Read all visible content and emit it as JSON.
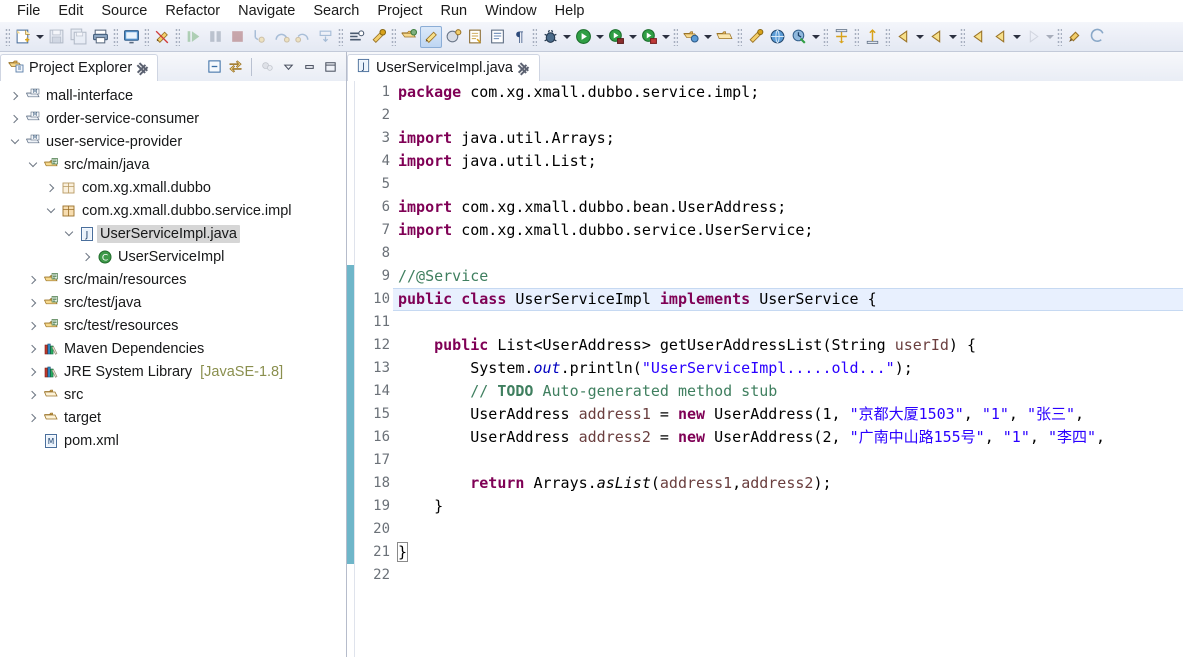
{
  "menu": {
    "items": [
      {
        "label": "File"
      },
      {
        "label": "Edit"
      },
      {
        "label": "Source"
      },
      {
        "label": "Refactor"
      },
      {
        "label": "Navigate"
      },
      {
        "label": "Search"
      },
      {
        "label": "Project"
      },
      {
        "label": "Run"
      },
      {
        "label": "Window"
      },
      {
        "label": "Help"
      }
    ]
  },
  "toolbar": {
    "groups": [
      {
        "buttons": [
          {
            "name": "new-wizard-icon",
            "enabled": true,
            "dropdown": true
          },
          {
            "name": "save-icon",
            "enabled": false
          },
          {
            "name": "save-all-icon",
            "enabled": false
          },
          {
            "name": "print-icon",
            "enabled": true
          }
        ]
      },
      {
        "buttons": [
          {
            "name": "open-console-icon",
            "enabled": true
          }
        ]
      },
      {
        "buttons": [
          {
            "name": "toggle-mark-occurrences-icon",
            "enabled": true
          }
        ]
      },
      {
        "buttons": [
          {
            "name": "resume-icon",
            "enabled": false
          },
          {
            "name": "suspend-icon",
            "enabled": false
          },
          {
            "name": "terminate-icon",
            "enabled": false
          },
          {
            "name": "step-into-icon",
            "enabled": false
          },
          {
            "name": "step-over-icon",
            "enabled": false
          },
          {
            "name": "step-return-icon",
            "enabled": false
          },
          {
            "name": "drop-to-frame-icon",
            "enabled": false
          }
        ]
      },
      {
        "buttons": [
          {
            "name": "skip-breakpoints-icon",
            "enabled": true
          },
          {
            "name": "run-last-tool-icon",
            "enabled": true
          }
        ]
      },
      {
        "buttons": [
          {
            "name": "new-java-project-icon",
            "enabled": true
          },
          {
            "name": "new-package-icon",
            "enabled": true,
            "highlighted": true
          },
          {
            "name": "new-class-icon",
            "enabled": true
          },
          {
            "name": "open-type-icon",
            "enabled": true
          },
          {
            "name": "open-task-icon",
            "enabled": true
          },
          {
            "name": "show-whitespace-icon",
            "enabled": true
          }
        ]
      },
      {
        "buttons": [
          {
            "name": "debug-icon",
            "enabled": true,
            "dropdown": true
          },
          {
            "name": "run-icon",
            "enabled": true,
            "dropdown": true
          },
          {
            "name": "run-server-icon",
            "enabled": true,
            "dropdown": true
          },
          {
            "name": "profile-icon",
            "enabled": true,
            "dropdown": true
          }
        ]
      },
      {
        "buttons": [
          {
            "name": "new-connection-icon",
            "enabled": true,
            "dropdown": true
          },
          {
            "name": "open-web-browser-icon",
            "enabled": true
          }
        ]
      },
      {
        "buttons": [
          {
            "name": "search-icon",
            "enabled": true
          },
          {
            "name": "open-resource-icon",
            "enabled": true
          },
          {
            "name": "external-tools-icon",
            "enabled": true,
            "dropdown": true
          }
        ]
      },
      {
        "buttons": [
          {
            "name": "globe-icon",
            "enabled": true
          }
        ]
      },
      {
        "buttons": [
          {
            "name": "deploy-icon",
            "enabled": true
          }
        ]
      },
      {
        "buttons": [
          {
            "name": "next-annotation-icon",
            "enabled": true,
            "dropdown": true
          },
          {
            "name": "previous-annotation-icon",
            "enabled": true,
            "dropdown": true
          }
        ]
      },
      {
        "buttons": [
          {
            "name": "back-icon",
            "enabled": true
          },
          {
            "name": "backward-history-icon",
            "enabled": true,
            "dropdown": true
          },
          {
            "name": "forward-history-icon",
            "enabled": false,
            "dropdown": true
          }
        ]
      },
      {
        "buttons": [
          {
            "name": "pin-editor-icon",
            "enabled": true
          },
          {
            "name": "last-edit-location-icon",
            "enabled": true
          }
        ]
      }
    ]
  },
  "explorer": {
    "tab": {
      "title": "Project Explorer",
      "icon": "project-explorer-icon",
      "close": "close-icon"
    },
    "toolbar": [
      {
        "name": "collapse-all-icon"
      },
      {
        "name": "link-with-editor-icon"
      },
      {
        "name": "focus-on-active-task-icon"
      },
      {
        "name": "view-menu-icon"
      },
      {
        "name": "minimize-icon"
      },
      {
        "name": "maximize-icon"
      }
    ],
    "tree": [
      {
        "label": "mall-interface",
        "indent": 0,
        "twisty": "closed",
        "icon": "maven-project-icon",
        "selected": false
      },
      {
        "label": "order-service-consumer",
        "indent": 0,
        "twisty": "closed",
        "icon": "maven-project-icon",
        "selected": false
      },
      {
        "label": "user-service-provider",
        "indent": 0,
        "twisty": "open",
        "icon": "maven-project-icon",
        "selected": false
      },
      {
        "label": "src/main/java",
        "indent": 1,
        "twisty": "open",
        "icon": "source-folder-icon",
        "selected": false
      },
      {
        "label": "com.xg.xmall.dubbo",
        "indent": 2,
        "twisty": "closed",
        "icon": "package-empty-icon",
        "selected": false
      },
      {
        "label": "com.xg.xmall.dubbo.service.impl",
        "indent": 2,
        "twisty": "open",
        "icon": "package-icon",
        "selected": false
      },
      {
        "label": "UserServiceImpl.java",
        "indent": 3,
        "twisty": "open",
        "icon": "java-file-icon",
        "selected": true
      },
      {
        "label": "UserServiceImpl",
        "indent": 4,
        "twisty": "closed",
        "icon": "java-class-icon",
        "selected": false
      },
      {
        "label": "src/main/resources",
        "indent": 1,
        "twisty": "closed",
        "icon": "source-folder-icon",
        "selected": false
      },
      {
        "label": "src/test/java",
        "indent": 1,
        "twisty": "closed",
        "icon": "source-folder-icon",
        "selected": false
      },
      {
        "label": "src/test/resources",
        "indent": 1,
        "twisty": "closed",
        "icon": "source-folder-icon",
        "selected": false
      },
      {
        "label": "Maven Dependencies",
        "indent": 1,
        "twisty": "closed",
        "icon": "library-icon",
        "selected": false
      },
      {
        "label": "JRE System Library",
        "indent": 1,
        "twisty": "closed",
        "icon": "library-icon",
        "selected": false,
        "suffix": "[JavaSE-1.8]"
      },
      {
        "label": "src",
        "indent": 1,
        "twisty": "closed",
        "icon": "folder-icon",
        "selected": false
      },
      {
        "label": "target",
        "indent": 1,
        "twisty": "closed",
        "icon": "folder-icon",
        "selected": false
      },
      {
        "label": "pom.xml",
        "indent": 1,
        "twisty": "none",
        "icon": "xml-file-icon",
        "selected": false
      }
    ]
  },
  "editor": {
    "tab": {
      "title": "UserServiceImpl.java",
      "icon": "java-file-icon",
      "close": "close-icon"
    },
    "current_line": 10,
    "lines": [
      {
        "n": 1,
        "fold": false,
        "changed": false,
        "tokens": [
          {
            "t": "package ",
            "c": "kw"
          },
          {
            "t": "com.xg.xmall.dubbo.service.impl;",
            "c": ""
          }
        ]
      },
      {
        "n": 2,
        "fold": false,
        "changed": false,
        "tokens": []
      },
      {
        "n": 3,
        "fold": true,
        "changed": false,
        "tokens": [
          {
            "t": "import ",
            "c": "kw"
          },
          {
            "t": "java.util.Arrays;",
            "c": ""
          }
        ]
      },
      {
        "n": 4,
        "fold": false,
        "changed": false,
        "tokens": [
          {
            "t": "import ",
            "c": "kw"
          },
          {
            "t": "java.util.List;",
            "c": ""
          }
        ]
      },
      {
        "n": 5,
        "fold": false,
        "changed": false,
        "tokens": []
      },
      {
        "n": 6,
        "fold": false,
        "changed": false,
        "tokens": [
          {
            "t": "import ",
            "c": "kw"
          },
          {
            "t": "com.xg.xmall.dubbo.bean.UserAddress;",
            "c": ""
          }
        ]
      },
      {
        "n": 7,
        "fold": false,
        "changed": false,
        "tokens": [
          {
            "t": "import ",
            "c": "kw"
          },
          {
            "t": "com.xg.xmall.dubbo.service.UserService;",
            "c": ""
          }
        ]
      },
      {
        "n": 8,
        "fold": false,
        "changed": false,
        "tokens": []
      },
      {
        "n": 9,
        "fold": false,
        "changed": true,
        "tokens": [
          {
            "t": "//@Service",
            "c": "cmt"
          }
        ]
      },
      {
        "n": 10,
        "fold": false,
        "changed": true,
        "tokens": [
          {
            "t": "public ",
            "c": "kw"
          },
          {
            "t": "class ",
            "c": "kw"
          },
          {
            "t": "UserServiceImpl ",
            "c": ""
          },
          {
            "t": "implements ",
            "c": "kw"
          },
          {
            "t": "UserService {",
            "c": ""
          }
        ]
      },
      {
        "n": 11,
        "fold": false,
        "changed": true,
        "tokens": []
      },
      {
        "n": 12,
        "fold": true,
        "changed": true,
        "tokens": [
          {
            "t": "    ",
            "c": ""
          },
          {
            "t": "public ",
            "c": "kw"
          },
          {
            "t": "List<UserAddress> getUserAddressList(String ",
            "c": ""
          },
          {
            "t": "userId",
            "c": "par"
          },
          {
            "t": ") {",
            "c": ""
          }
        ]
      },
      {
        "n": 13,
        "fold": false,
        "changed": true,
        "tokens": [
          {
            "t": "        System.",
            "c": ""
          },
          {
            "t": "out",
            "c": "fld"
          },
          {
            "t": ".println(",
            "c": ""
          },
          {
            "t": "\"UserServiceImpl.....old...\"",
            "c": "str"
          },
          {
            "t": ");",
            "c": ""
          }
        ]
      },
      {
        "n": 14,
        "fold": false,
        "changed": true,
        "tokens": [
          {
            "t": "        ",
            "c": ""
          },
          {
            "t": "// ",
            "c": "cmt"
          },
          {
            "t": "TODO",
            "c": "todo"
          },
          {
            "t": " Auto-generated method stub",
            "c": "cmt"
          }
        ]
      },
      {
        "n": 15,
        "fold": false,
        "changed": true,
        "tokens": [
          {
            "t": "        UserAddress ",
            "c": ""
          },
          {
            "t": "address1",
            "c": "par"
          },
          {
            "t": " = ",
            "c": ""
          },
          {
            "t": "new ",
            "c": "kw"
          },
          {
            "t": "UserAddress(1, ",
            "c": ""
          },
          {
            "t": "\"京都大厦1503\"",
            "c": "str"
          },
          {
            "t": ", ",
            "c": ""
          },
          {
            "t": "\"1\"",
            "c": "str"
          },
          {
            "t": ", ",
            "c": ""
          },
          {
            "t": "\"张三\"",
            "c": "str"
          },
          {
            "t": ", ",
            "c": ""
          }
        ]
      },
      {
        "n": 16,
        "fold": false,
        "changed": true,
        "tokens": [
          {
            "t": "        UserAddress ",
            "c": ""
          },
          {
            "t": "address2",
            "c": "par"
          },
          {
            "t": " = ",
            "c": ""
          },
          {
            "t": "new ",
            "c": "kw"
          },
          {
            "t": "UserAddress(2, ",
            "c": ""
          },
          {
            "t": "\"广南中山路155号\"",
            "c": "str"
          },
          {
            "t": ", ",
            "c": ""
          },
          {
            "t": "\"1\"",
            "c": "str"
          },
          {
            "t": ", ",
            "c": ""
          },
          {
            "t": "\"李四\"",
            "c": "str"
          },
          {
            "t": ", ",
            "c": ""
          }
        ]
      },
      {
        "n": 17,
        "fold": false,
        "changed": true,
        "tokens": []
      },
      {
        "n": 18,
        "fold": false,
        "changed": true,
        "tokens": [
          {
            "t": "        ",
            "c": ""
          },
          {
            "t": "return ",
            "c": "kw"
          },
          {
            "t": "Arrays.",
            "c": ""
          },
          {
            "t": "asList",
            "c": "stat"
          },
          {
            "t": "(",
            "c": ""
          },
          {
            "t": "address1",
            "c": "par"
          },
          {
            "t": ",",
            "c": ""
          },
          {
            "t": "address2",
            "c": "par"
          },
          {
            "t": ");",
            "c": ""
          }
        ]
      },
      {
        "n": 19,
        "fold": false,
        "changed": true,
        "tokens": [
          {
            "t": "    }",
            "c": ""
          }
        ]
      },
      {
        "n": 20,
        "fold": false,
        "changed": true,
        "tokens": []
      },
      {
        "n": 21,
        "fold": false,
        "changed": true,
        "tokens": [
          {
            "t": "}",
            "c": "brk"
          }
        ]
      },
      {
        "n": 22,
        "fold": false,
        "changed": false,
        "tokens": []
      }
    ]
  },
  "colors": {
    "keyword": "#7F0055",
    "string": "#2A00FF",
    "comment": "#3F7F5F",
    "field": "#0000C0",
    "parameter": "#6A3E3E",
    "current_line": "#E8F0FE",
    "selection": "#D6D6D6",
    "change_bar": "#6FB6C9"
  }
}
